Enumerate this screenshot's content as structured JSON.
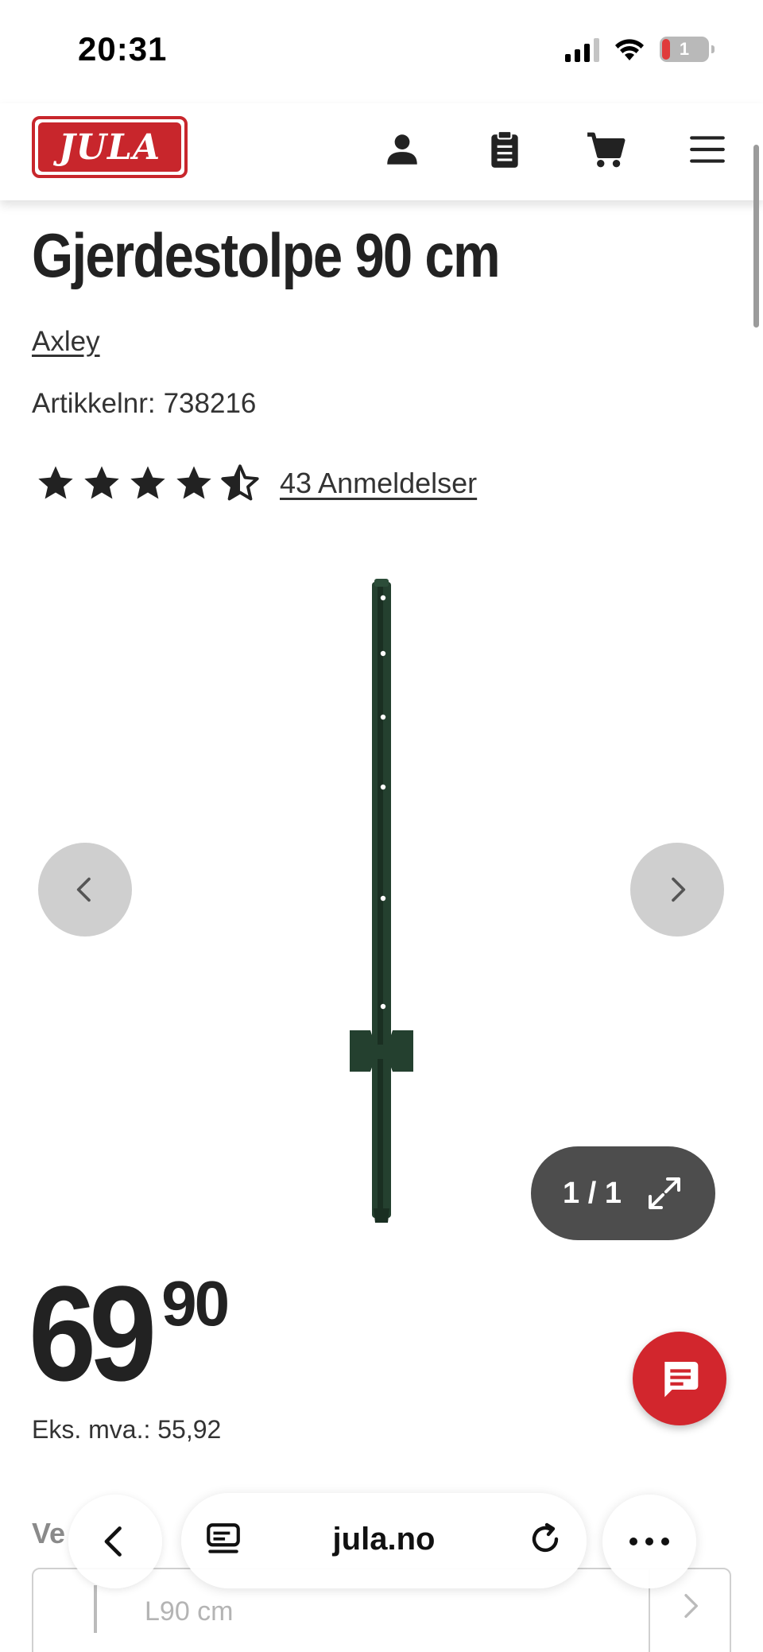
{
  "status_bar": {
    "time": "20:31",
    "battery": "1"
  },
  "header": {
    "logo_text": "JULA",
    "icons": [
      "account-icon",
      "shopping-list-icon",
      "cart-icon",
      "menu-icon"
    ]
  },
  "product": {
    "title": "Gjerdestolpe 90 cm",
    "brand": "Axley",
    "article_label": "Artikkelnr:",
    "article_number": "738216",
    "rating": 4.5,
    "rating_max": 5,
    "reviews_label": "43 Anmeldelser"
  },
  "gallery": {
    "counter": "1 / 1",
    "image_description_icon": "fence-post-image"
  },
  "price": {
    "integer": "69",
    "decimals": "90",
    "ex_vat_label": "Eks. mva.:",
    "ex_vat_value": "55,92"
  },
  "variant": {
    "label": "Ve",
    "value": "L90 cm"
  },
  "browser": {
    "url": "jula.no"
  },
  "colors": {
    "brand_red": "#c8262c",
    "chat_red": "#d2262d",
    "text": "#222222",
    "gallery_button": "#cfcfcf",
    "counter_bg": "#4d4d4d",
    "post_green": "#24402f"
  }
}
